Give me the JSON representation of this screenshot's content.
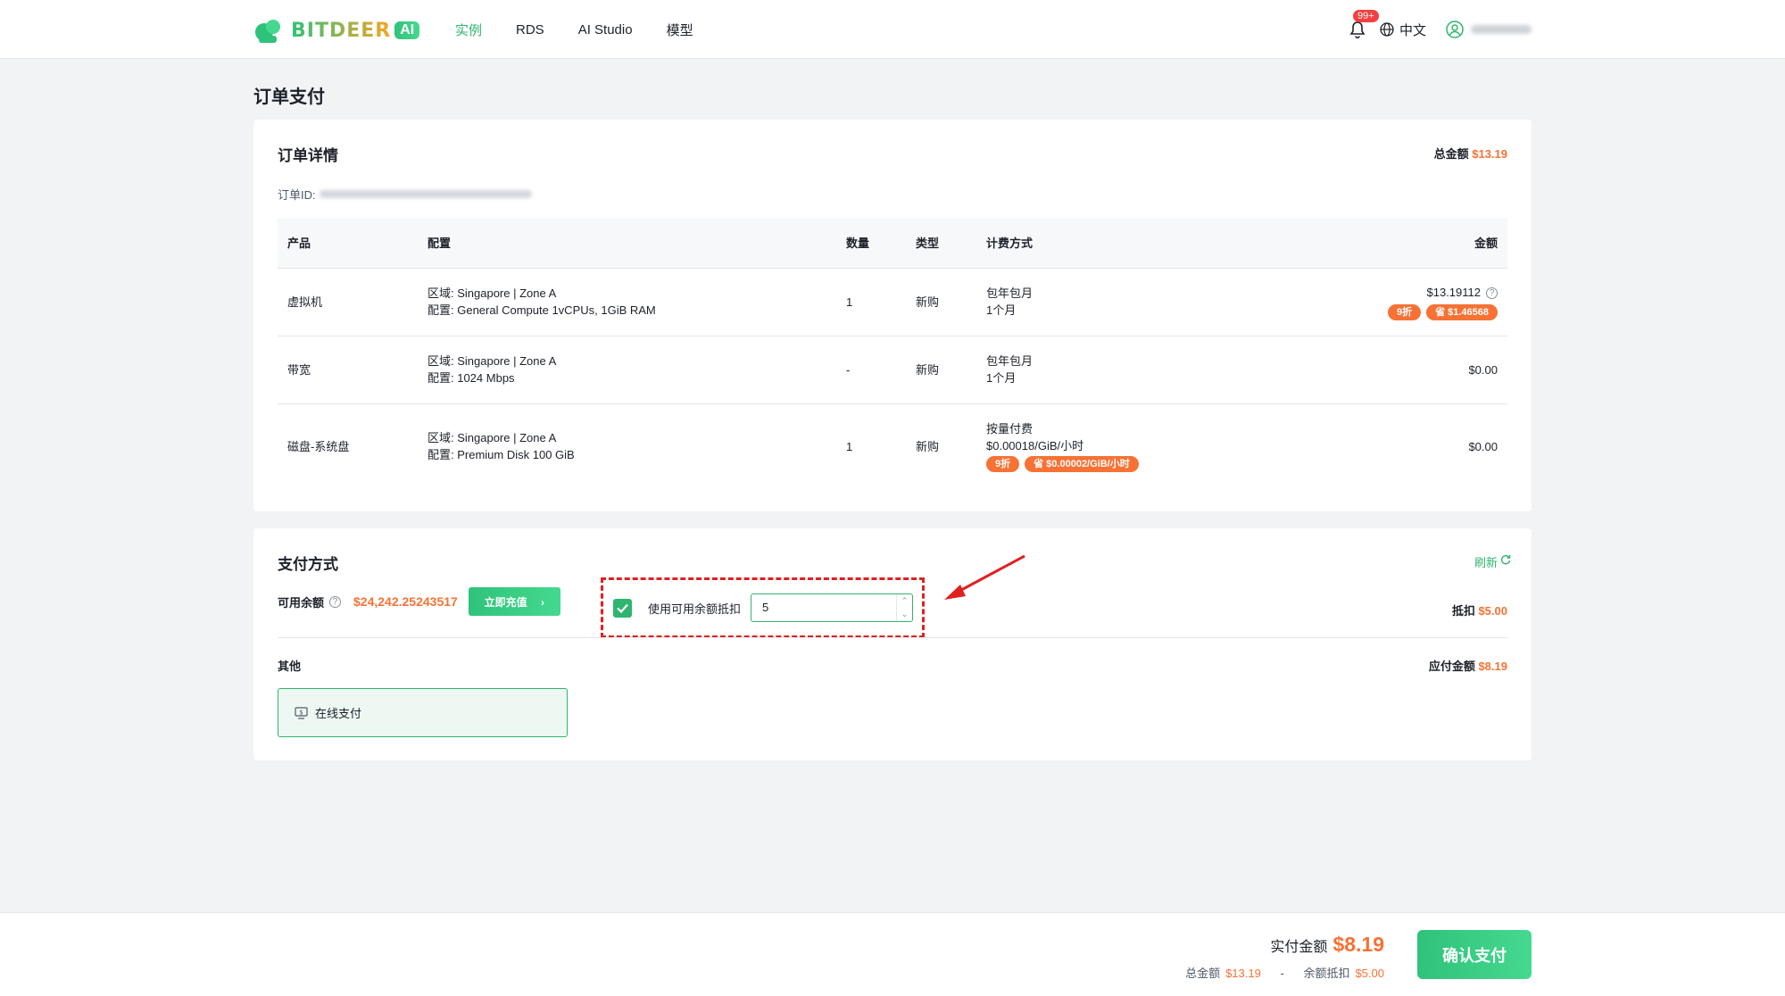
{
  "header": {
    "logo_text": "BITDEER",
    "logo_ai": "AI",
    "nav": [
      "实例",
      "RDS",
      "AI Studio",
      "模型"
    ],
    "notification_badge": "99+",
    "language": "中文",
    "colors": {
      "accent": "#2fb56f",
      "price": "#f77234",
      "annotation": "#e02020"
    }
  },
  "page_title": "订单支付",
  "order": {
    "title": "订单详情",
    "total_label": "总金额",
    "total_value": "$13.19",
    "id_label": "订单ID:",
    "columns": [
      "产品",
      "配置",
      "数量",
      "类型",
      "计费方式",
      "金额"
    ],
    "rows": [
      {
        "product": "虚拟机",
        "config1": "区域: Singapore | Zone A",
        "config2": "配置: General Compute 1vCPUs, 1GiB RAM",
        "qty": "1",
        "type": "新购",
        "billing1": "包年包月",
        "billing2": "1个月",
        "amount": "$13.19112",
        "discount": "9折",
        "saved": "省 $1.46568"
      },
      {
        "product": "带宽",
        "config1": "区域: Singapore | Zone A",
        "config2": "配置: 1024 Mbps",
        "qty": "-",
        "type": "新购",
        "billing1": "包年包月",
        "billing2": "1个月",
        "amount": "$0.00"
      },
      {
        "product": "磁盘-系统盘",
        "config1": "区域: Singapore | Zone A",
        "config2": "配置: Premium Disk 100 GiB",
        "qty": "1",
        "type": "新购",
        "billing1": "按量付费",
        "billing2": "$0.00018/GiB/小时",
        "discount": "9折",
        "saved": "省 $0.00002/GiB/小时",
        "amount": "$0.00"
      }
    ]
  },
  "payment": {
    "title": "支付方式",
    "refresh": "刷新",
    "balance_label": "可用余额",
    "balance_value": "$24,242.25243517",
    "recharge_button": "立即充值",
    "use_balance_label": "使用可用余额抵扣",
    "use_balance_checked": true,
    "deduct_input_value": "5",
    "deduct_label": "抵扣",
    "deduct_value": "$5.00",
    "other_label": "其他",
    "due_label": "应付金额",
    "due_value": "$8.19",
    "online_pay": "在线支付"
  },
  "footer": {
    "actual_label": "实付金额",
    "actual_value": "$8.19",
    "total_label": "总金额",
    "total_value": "$13.19",
    "minus": "-",
    "deduct_label": "余额抵扣",
    "deduct_value": "$5.00",
    "confirm_button": "确认支付"
  }
}
